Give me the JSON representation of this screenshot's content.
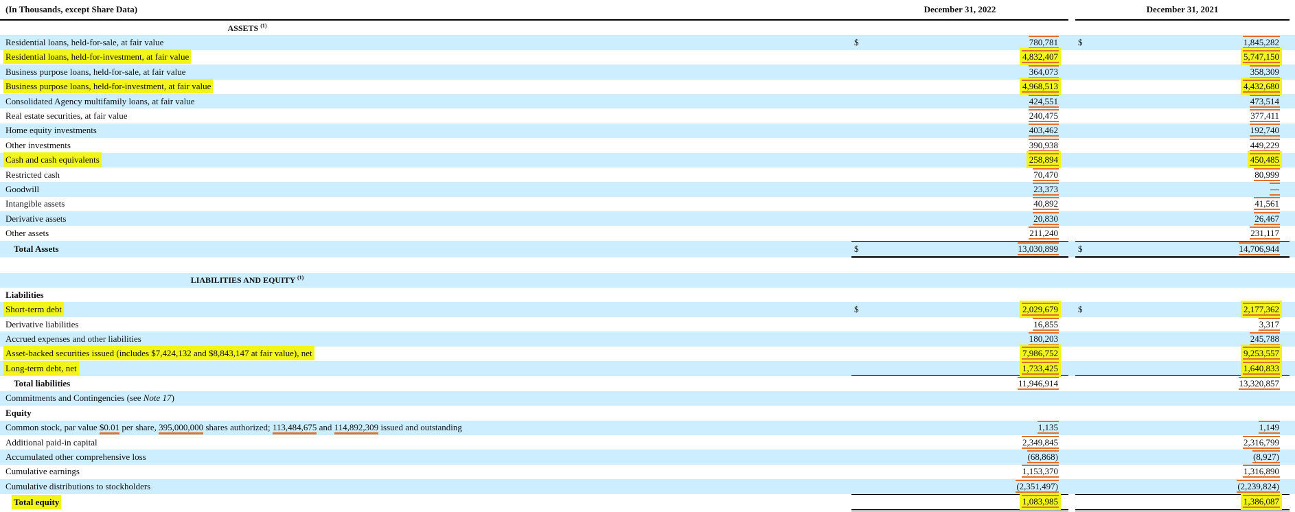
{
  "header": {
    "units": "(In Thousands, except Share Data)",
    "col1": "December 31, 2022",
    "col2": "December 31, 2021"
  },
  "assets_heading": "ASSETS",
  "assets_note": "(1)",
  "assets": [
    {
      "label": "Residential loans, held-for-sale, at fair value",
      "v1": "780,781",
      "v2": "1,845,282",
      "dollar": true,
      "hl": false
    },
    {
      "label": "Residential loans, held-for-investment, at fair value",
      "v1": "4,832,407",
      "v2": "5,747,150",
      "hl": true
    },
    {
      "label": "Business purpose loans, held-for-sale, at fair value",
      "v1": "364,073",
      "v2": "358,309",
      "hl": false
    },
    {
      "label": "Business purpose loans, held-for-investment, at fair value",
      "v1": "4,968,513",
      "v2": "4,432,680",
      "hl": true
    },
    {
      "label": "Consolidated Agency multifamily loans, at fair value",
      "v1": "424,551",
      "v2": "473,514",
      "hl": false
    },
    {
      "label": "Real estate securities, at fair value",
      "v1": "240,475",
      "v2": "377,411",
      "hl": false
    },
    {
      "label": "Home equity investments",
      "v1": "403,462",
      "v2": "192,740",
      "hl": false
    },
    {
      "label": "Other investments",
      "v1": "390,938",
      "v2": "449,229",
      "hl": false
    },
    {
      "label": "Cash and cash equivalents",
      "v1": "258,894",
      "v2": "450,485",
      "hl": true
    },
    {
      "label": "Restricted cash",
      "v1": "70,470",
      "v2": "80,999",
      "hl": false
    },
    {
      "label": "Goodwill",
      "v1": "23,373",
      "v2": "—",
      "hl": false
    },
    {
      "label": "Intangible assets",
      "v1": "40,892",
      "v2": "41,561",
      "hl": false
    },
    {
      "label": "Derivative assets",
      "v1": "20,830",
      "v2": "26,467",
      "hl": false
    },
    {
      "label": "Other assets",
      "v1": "211,240",
      "v2": "231,117",
      "hl": false
    }
  ],
  "total_assets": {
    "label": "Total Assets",
    "v1": "13,030,899",
    "v2": "14,706,944"
  },
  "liab_heading": "LIABILITIES AND EQUITY",
  "liab_note": "(1)",
  "liabilities_label": "Liabilities",
  "liabilities": [
    {
      "label": "Short-term debt",
      "v1": "2,029,679",
      "v2": "2,177,362",
      "hl": true
    },
    {
      "label": "Derivative liabilities",
      "v1": "16,855",
      "v2": "3,317",
      "hl": false
    },
    {
      "label": "Accrued expenses and other liabilities",
      "v1": "180,203",
      "v2": "245,788",
      "hl": false
    },
    {
      "label": "Asset-backed securities issued (includes $7,424,132 and $8,843,147 at fair value), net",
      "v1": "7,986,752",
      "v2": "9,253,557",
      "hl": true
    },
    {
      "label": "Long-term debt, net",
      "v1": "1,733,425",
      "v2": "1,640,833",
      "hl": true
    }
  ],
  "total_liabilities": {
    "label": "Total liabilities",
    "v1": "11,946,914",
    "v2": "13,320,857"
  },
  "commitments": {
    "text": "Commitments and Contingencies (see ",
    "note": "Note 17",
    "close": ")"
  },
  "equity_label": "Equity",
  "common_stock": {
    "t1": "Common stock, par value ",
    "par": "$0.01",
    "t2": " per share, ",
    "auth": "395,000,000",
    "t3": " shares authorized; ",
    "iss1": "113,484,675",
    "t4": " and ",
    "iss2": "114,892,309",
    "t5": " issued and outstanding",
    "v1": "1,135",
    "v2": "1,149"
  },
  "equity": [
    {
      "label": "Additional paid-in capital",
      "v1": "2,349,845",
      "v2": "2,316,799"
    },
    {
      "label": "Accumulated other comprehensive loss",
      "v1": "(68,868)",
      "v2": "(8,927)"
    },
    {
      "label": "Cumulative earnings",
      "v1": "1,153,370",
      "v2": "1,316,890"
    },
    {
      "label": "Cumulative distributions to stockholders",
      "v1": "(2,351,497)",
      "v2": "(2,239,824)"
    }
  ],
  "total_equity": {
    "label": "Total equity",
    "v1": "1,083,985",
    "v2": "1,386,087"
  },
  "currency": "$"
}
